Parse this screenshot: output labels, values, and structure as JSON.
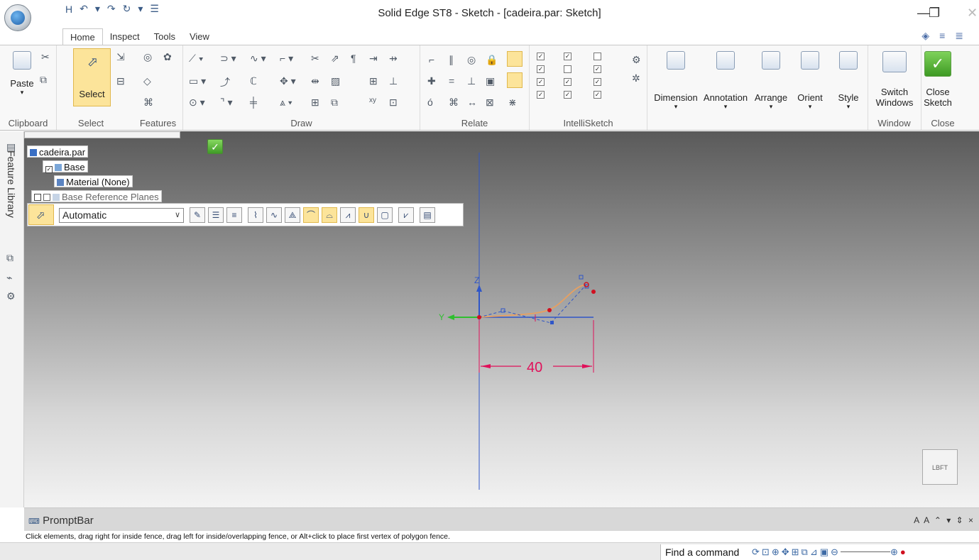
{
  "app": {
    "window_title": "Solid Edge ST8 - Sketch - [cadeira.par: Sketch]",
    "window_controls": {
      "minimize": "—",
      "restore": "❐",
      "close": "✕"
    }
  },
  "quick_access": [
    "H",
    "↶",
    "▾",
    "↷",
    "↻",
    "▾",
    "☰"
  ],
  "tabs": [
    "Home",
    "Inspect",
    "Tools",
    "View"
  ],
  "active_tab": "Home",
  "ribbon": {
    "groups": {
      "clipboard": "Clipboard",
      "select": "Select",
      "features": "Features",
      "draw": "Draw",
      "relate": "Relate",
      "intellisketch": "IntelliSketch",
      "window": "Window",
      "close": "Close"
    },
    "buttons": {
      "paste": "Paste",
      "select": "Select",
      "dimension": "Dimension",
      "annotation": "Annotation",
      "arrange": "Arrange",
      "orient": "Orient",
      "style": "Style",
      "switch_windows_1": "Switch",
      "switch_windows_2": "Windows",
      "close_sketch_1": "Close",
      "close_sketch_2": "Sketch"
    }
  },
  "side_panel": {
    "title": "Feature Library"
  },
  "tree": {
    "root": "cadeira.par",
    "items": [
      "Base",
      "Material (None)",
      "Base Reference Planes"
    ]
  },
  "command_bar": {
    "selection_mode": "Automatic"
  },
  "sketch": {
    "dimension_value": "40",
    "axis_z": "Z",
    "axis_y": "Y",
    "view_cube": "LBFT",
    "colors": {
      "curve": "#e8a060",
      "axis_blue": "#2f56c8",
      "axis_green": "#2fbf2f",
      "dimension": "#e0105a"
    }
  },
  "promptbar": {
    "title": "PromptBar",
    "controls": "A A ⌃ ▾ ⇕ ×",
    "message": "Click elements, drag right for inside fence, drag left for inside/overlapping fence, or Alt+click to place first vertex of polygon fence."
  },
  "statusbar": {
    "find_command": "Find a command"
  }
}
